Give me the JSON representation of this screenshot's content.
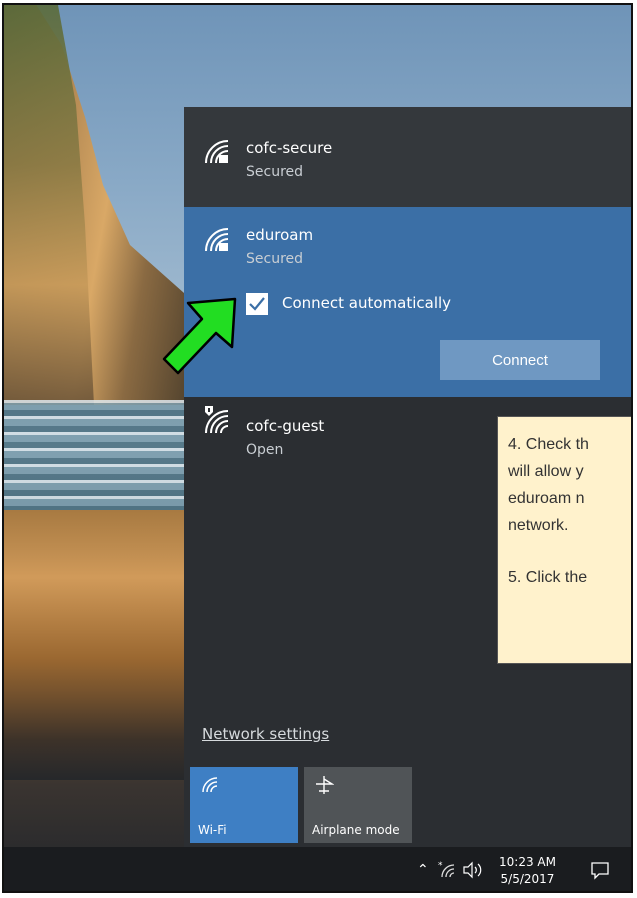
{
  "networks": [
    {
      "name": "cofc-secure",
      "status": "Secured"
    },
    {
      "name": "eduroam",
      "status": "Secured"
    },
    {
      "name": "cofc-guest",
      "status": "Open"
    }
  ],
  "selected_network": {
    "auto_connect_label": "Connect automatically",
    "auto_connect_checked": true,
    "connect_label": "Connect"
  },
  "network_settings_label": "Network settings",
  "quick_actions": [
    {
      "label": "Wi-Fi",
      "icon": "wifi-icon",
      "active": true
    },
    {
      "label": "Airplane mode",
      "icon": "airplane-icon",
      "active": false
    }
  ],
  "taskbar": {
    "time": "10:23 AM",
    "date": "5/5/2017"
  },
  "callout": {
    "lines_step4": [
      "4. Check th",
      "will allow y",
      "eduroam n",
      "network."
    ],
    "line_step5": "5. Click the"
  },
  "colors": {
    "accent": "#3b6fa6",
    "panel": "#2b2e32",
    "callout_bg": "#fff2cc",
    "arrow": "#22dd22"
  }
}
